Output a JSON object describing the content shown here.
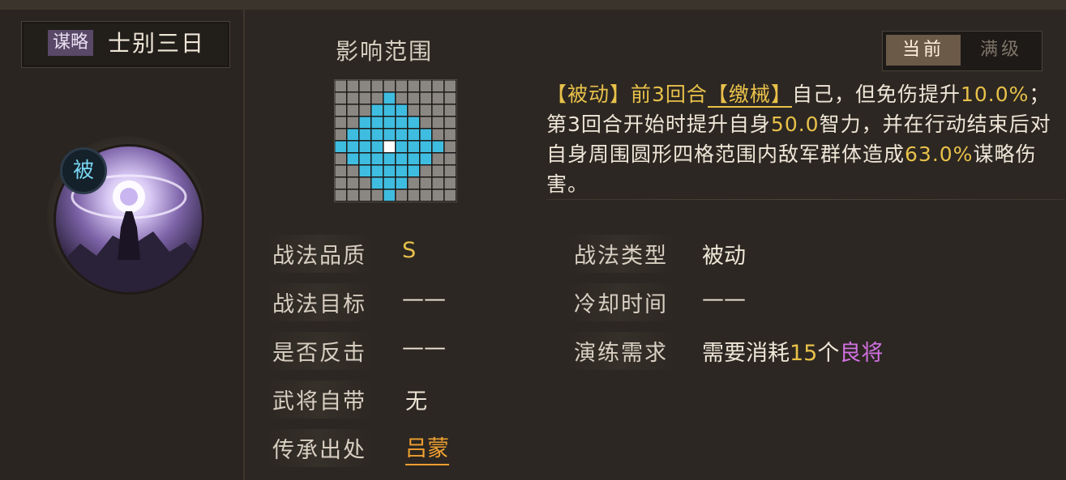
{
  "skill": {
    "type_tag": "谋略",
    "name": "士别三日",
    "badge": "被"
  },
  "range": {
    "title": "影响范围",
    "grid": [
      "0000000000",
      "0000100000",
      "0001110000",
      "0011111000",
      "0111111100",
      "1111211110",
      "0111111100",
      "0011111000",
      "0001110000",
      "0000100000"
    ]
  },
  "toggle": {
    "current": "当前",
    "max": "满级"
  },
  "description": {
    "p1": "【被动】前3回合",
    "p2": "【缴械】",
    "p3": "自己，但免伤提升",
    "p4": "10.0%",
    "p5": "；第3回合开始时提升自身",
    "p6": "50.0",
    "p7": "智力，并在行动结束后对自身周围圆形四格范围内敌军群体造成",
    "p8": "63.0%",
    "p9": "谋略伤害。"
  },
  "attributes": {
    "quality_label": "战法品质",
    "quality_value": "S",
    "type_label": "战法类型",
    "type_value": "被动",
    "target_label": "战法目标",
    "target_value": "——",
    "cooldown_label": "冷却时间",
    "cooldown_value": "——",
    "counter_label": "是否反击",
    "counter_value": "——",
    "drill_label": "演练需求",
    "drill_prefix": "需要消耗",
    "drill_count": "15",
    "drill_unit": "个",
    "drill_item": "良将",
    "innate_label": "武将自带",
    "innate_value": "无",
    "source_label": "传承出处",
    "source_value": "吕蒙"
  },
  "colors": {
    "gold": "#e8c14a",
    "cyan_cell": "#3fbde0",
    "purple": "#d070e0",
    "orange": "#f0a030"
  }
}
